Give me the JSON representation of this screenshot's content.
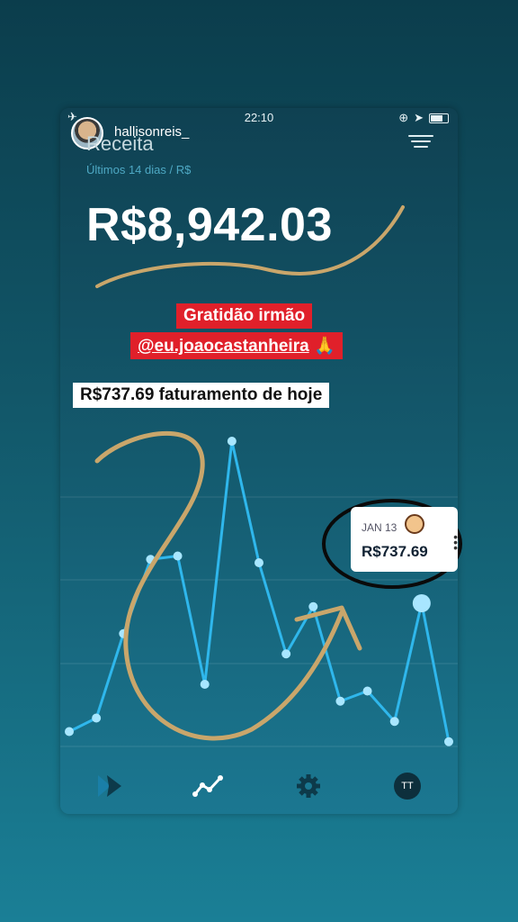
{
  "status_bar": {
    "time": "22:10"
  },
  "story": {
    "username": "hallisonreis_"
  },
  "screen": {
    "title": "Receita",
    "subtitle": "Últimos 14 dias / R$",
    "total": "R$8,942.03"
  },
  "stickers": {
    "line1": "Gratidão irmão",
    "line2_handle": "@eu.joaocastanheira",
    "line2_emoji": "🙏",
    "today_label": "R$737.69 faturamento de hoje"
  },
  "tooltip": {
    "date": "JAN 13",
    "value": "R$737.69"
  },
  "tabbar": {
    "profile_initials": "TT"
  },
  "chart_data": {
    "type": "line",
    "title": "",
    "xlabel": "",
    "ylabel": "",
    "series": [
      {
        "values": [
          0.06,
          0.1,
          0.35,
          0.57,
          0.58,
          0.2,
          0.92,
          0.56,
          0.29,
          0.43,
          0.15,
          0.18,
          0.09,
          0.44,
          0.03
        ]
      }
    ],
    "highlighted_point_index": 13,
    "colors": {
      "line": "#2fb7ec",
      "point": "#a8e6ff"
    }
  }
}
